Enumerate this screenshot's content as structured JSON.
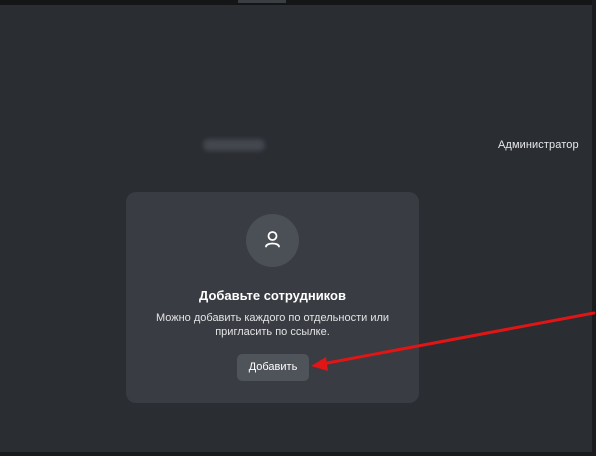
{
  "header": {
    "role_label": "Администратор"
  },
  "empty_state": {
    "icon": "user-icon",
    "title": "Добавьте сотрудников",
    "description": "Можно добавить каждого по отдельности или пригласить по ссылке.",
    "add_button_label": "Добавить"
  },
  "annotation": {
    "arrow_color": "#e01515"
  },
  "colors": {
    "background": "#2a2d32",
    "card": "#393c42",
    "button": "#4f535a"
  }
}
